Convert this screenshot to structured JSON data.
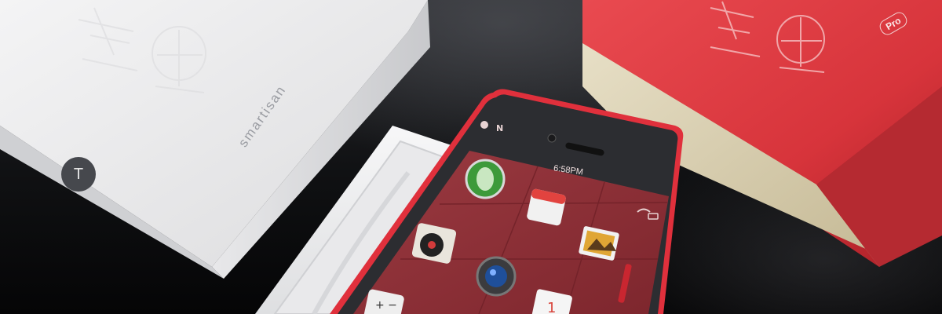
{
  "scene": {
    "white_box": {
      "brand_text": "smartisan",
      "logo_letter": "T"
    },
    "red_box": {
      "badge_text": "Pro"
    },
    "phone": {
      "status_time": "6:58PM",
      "app_icons": [
        "speaker-grille-icon",
        "calendar-icon",
        "record-player-icon",
        "photos-icon",
        "camera-icon",
        "calculator-icon",
        "calendar-page-icon"
      ]
    },
    "colors": {
      "white_box": "#eeeeef",
      "red_box": "#d93a40",
      "box_inner_gold": "#d8cfb0",
      "phone_screen": "#8c2f36",
      "phone_frame": "#2c2d31",
      "phone_rim": "#e0303c",
      "background": "#0d0d0f"
    }
  }
}
